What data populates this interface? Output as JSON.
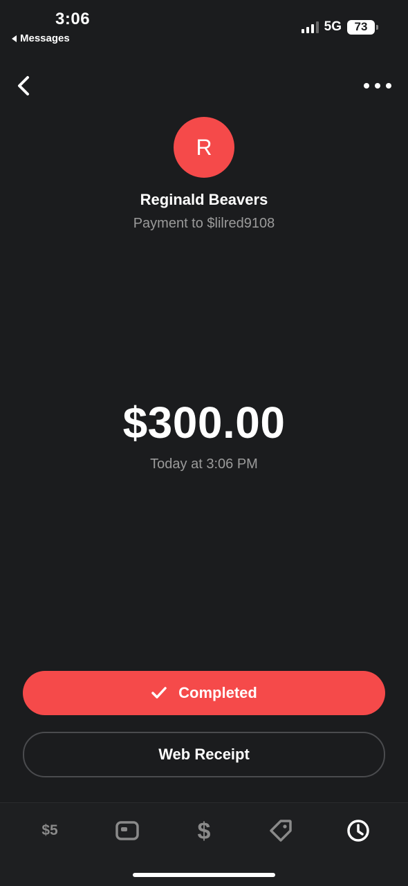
{
  "status_bar": {
    "time": "3:06",
    "back_app": "Messages",
    "network": "5G",
    "battery": "73"
  },
  "recipient": {
    "initial": "R",
    "name": "Reginald Beavers",
    "subtitle": "Payment to $lilred9108",
    "avatar_color": "#f54a4a"
  },
  "payment": {
    "amount": "$300.00",
    "timestamp": "Today at 3:06 PM"
  },
  "actions": {
    "status_label": "Completed",
    "receipt_label": "Web Receipt"
  },
  "tab_bar": {
    "items": [
      {
        "label": "$5",
        "icon": "money-icon"
      },
      {
        "label": "",
        "icon": "card-icon"
      },
      {
        "label": "",
        "icon": "dollar-icon"
      },
      {
        "label": "",
        "icon": "tag-icon"
      },
      {
        "label": "",
        "icon": "clock-icon"
      }
    ],
    "active_index": 4
  },
  "colors": {
    "background": "#1b1c1e",
    "accent": "#f54a4a",
    "muted_text": "#9b9b9b"
  }
}
